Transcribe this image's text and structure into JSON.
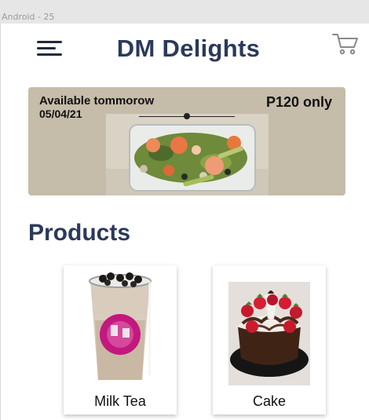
{
  "frame": {
    "label": "Android - 25"
  },
  "header": {
    "title": "DM Delights",
    "menu_icon": "hamburger-menu-icon",
    "cart_icon": "shopping-cart-icon"
  },
  "promo": {
    "availability": "Available tommorow",
    "date": "05/04/21",
    "price": "P120 only"
  },
  "products": {
    "section_title": "Products",
    "items": [
      {
        "name": "Milk Tea"
      },
      {
        "name": "Cake"
      }
    ]
  },
  "colors": {
    "title": "#2b3a5a",
    "banner": "#c5bca9",
    "text": "#111111"
  }
}
